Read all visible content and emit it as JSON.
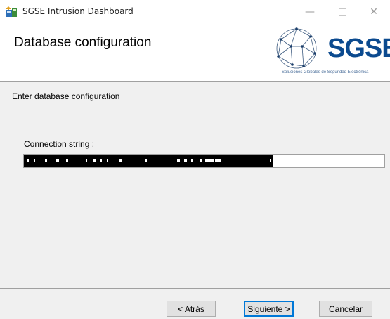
{
  "window": {
    "title": "SGSE Intrusion Dashboard",
    "minimize_glyph": "—",
    "close_glyph": "✕",
    "icon": "installer-icon"
  },
  "header": {
    "page_title": "Database configuration",
    "logo": {
      "wordmark": "SGSE",
      "tagline": "Soluciones Globales de Seguridad Electrónica",
      "brand_color": "#0b4a8f"
    }
  },
  "content": {
    "instruction": "Enter database configuration",
    "connection_label": "Connection string :",
    "connection_value": ""
  },
  "buttons": {
    "back": "< Atrás",
    "next": "Siguiente >",
    "cancel": "Cancelar"
  },
  "colors": {
    "focus_border": "#0078d7",
    "dialog_bg": "#f0f0f0",
    "redaction": "#000000"
  }
}
